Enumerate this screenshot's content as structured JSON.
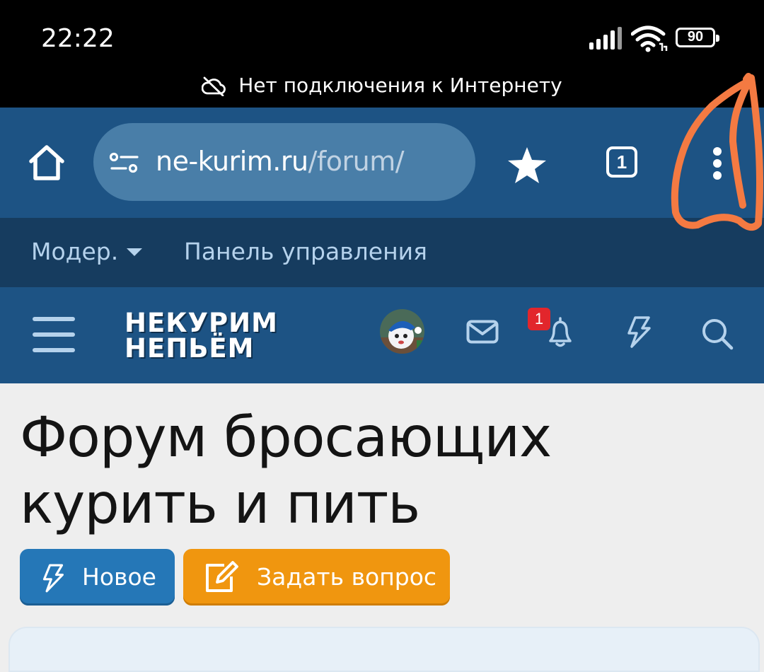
{
  "status_bar": {
    "time": "22:22",
    "battery": "90",
    "offline_message": "Нет подключения к Интернету"
  },
  "browser": {
    "url_domain": "ne-kurim.ru",
    "url_path": "/forum/",
    "tab_count": "1"
  },
  "mod_bar": {
    "moderator_label": "Модер.",
    "panel_label": "Панель управления"
  },
  "site": {
    "logo_line1": "НЕКУРИМ",
    "logo_line2": "НЕПЬЁМ",
    "notification_count": "1"
  },
  "page": {
    "title": "Форум бросающих курить и пить",
    "new_button": "Новое",
    "ask_button": "Задать вопрос"
  },
  "colors": {
    "toolbar": "#1d5384",
    "mod_bar": "#163c5f",
    "new_button": "#2577b7",
    "ask_button": "#f0960f",
    "annotation": "#f47a42"
  }
}
